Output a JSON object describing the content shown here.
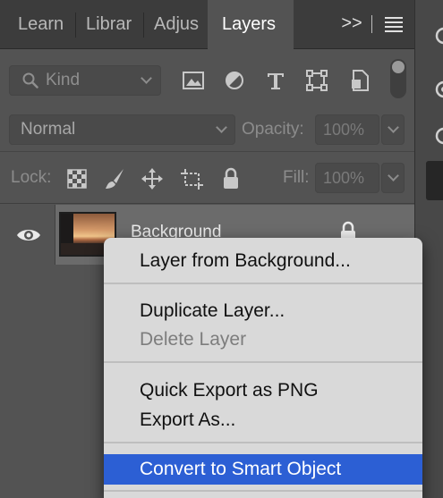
{
  "tabs": [
    {
      "label": "Learn"
    },
    {
      "label": "Librar"
    },
    {
      "label": "Adjus"
    },
    {
      "label": "Layers"
    }
  ],
  "tab_more_label": ">>",
  "filter": {
    "kind_label": "Kind"
  },
  "blend": {
    "mode": "Normal",
    "opacity_label": "Opacity:",
    "opacity_value": "100%"
  },
  "lock": {
    "label": "Lock:",
    "fill_label": "Fill:",
    "fill_value": "100%"
  },
  "layer": {
    "name": "Background"
  },
  "context_menu": {
    "items": [
      {
        "label": "Layer from Background...",
        "enabled": true
      },
      {
        "label": "Duplicate Layer...",
        "enabled": true
      },
      {
        "label": "Delete Layer",
        "enabled": false
      },
      {
        "label": "Quick Export as PNG",
        "enabled": true
      },
      {
        "label": "Export As...",
        "enabled": true
      },
      {
        "label": "Convert to Smart Object",
        "enabled": true,
        "highlighted": true
      }
    ]
  },
  "colors": {
    "panel_bg": "#535353",
    "tabbar_bg": "#3c3c3c",
    "menu_bg": "#d9d9d9",
    "highlight": "#2c5fd4"
  }
}
